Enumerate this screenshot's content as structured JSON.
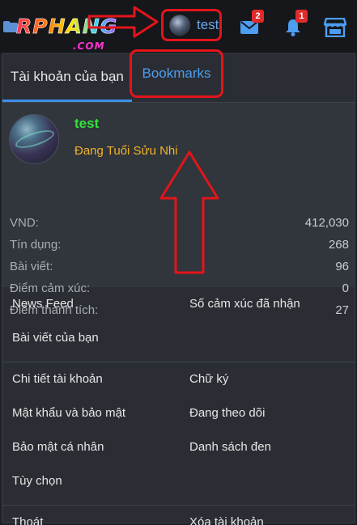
{
  "header": {
    "logo_main": "RPHANG",
    "logo_sub": ".COM",
    "username": "test",
    "messages_badge": "2",
    "alerts_badge": "1"
  },
  "tabs": {
    "account_label": "Tài khoản của bạn",
    "bookmarks_label": "Bookmarks"
  },
  "profile": {
    "name": "test",
    "title": "Đang Tuổi Sửu Nhi"
  },
  "stats": [
    {
      "label": "VND:",
      "value": "412,030"
    },
    {
      "label": "Tín dụng:",
      "value": "268"
    },
    {
      "label": "Bài viết:",
      "value": "96"
    },
    {
      "label": "Điểm cảm xúc:",
      "value": "0"
    },
    {
      "label": "Điểm thành tích:",
      "value": "27"
    }
  ],
  "links": {
    "news_feed": "News Feed",
    "reactions_received": "Số cảm xúc đã nhận",
    "your_posts": "Bài viết của bạn",
    "account_details": "Chi tiết tài khoản",
    "signature": "Chữ ký",
    "password_security": "Mật khẩu và bảo mật",
    "following": "Đang theo dõi",
    "privacy": "Bảo mật cá nhân",
    "ignoring": "Danh sách đen",
    "preferences": "Tùy chọn",
    "logout": "Thoát",
    "delete_account": "Xóa tài khoản"
  },
  "colors": {
    "accent": "#3d8fe6",
    "annotation_red": "#e3151a",
    "username_green": "#34e23b",
    "title_gold": "#f0b429",
    "badge_red": "#e02b2b"
  },
  "icons": [
    "folder-icon",
    "envelope-icon",
    "bell-icon",
    "store-icon",
    "arrow-right-annotation",
    "arrow-up-annotation"
  ]
}
